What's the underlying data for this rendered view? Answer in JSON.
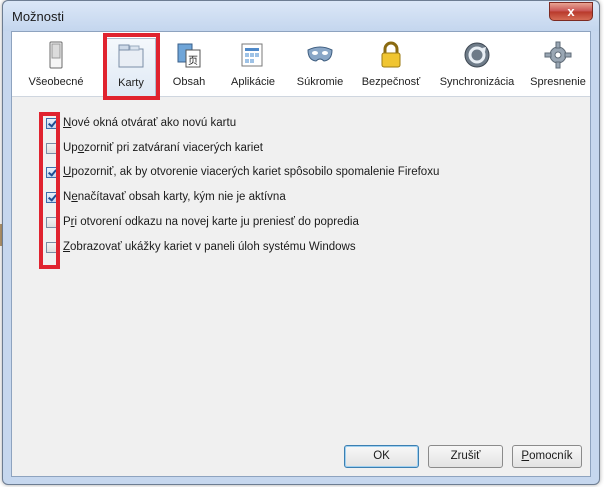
{
  "window": {
    "title": "Možnosti",
    "close_label": "x"
  },
  "toolbar": {
    "tabs": [
      {
        "id": "vseobecne",
        "label": "Všeobecné",
        "icon": "switch-icon"
      },
      {
        "id": "karty",
        "label": "Karty",
        "icon": "tabs-icon"
      },
      {
        "id": "obsah",
        "label": "Obsah",
        "icon": "content-icon"
      },
      {
        "id": "aplikacie",
        "label": "Aplikácie",
        "icon": "applications-icon"
      },
      {
        "id": "sukromie",
        "label": "Súkromie",
        "icon": "mask-icon"
      },
      {
        "id": "bezpecnost",
        "label": "Bezpečnosť",
        "icon": "lock-icon"
      },
      {
        "id": "synchronizacia",
        "label": "Synchronizácia",
        "icon": "sync-icon"
      },
      {
        "id": "spresnenie",
        "label": "Spresnenie",
        "icon": "gear-icon"
      }
    ],
    "selected": "Karty"
  },
  "options": [
    {
      "pre": "",
      "key": "N",
      "post": "ové okná otvárať ako novú kartu",
      "checked": true
    },
    {
      "pre": "Up",
      "key": "o",
      "post": "zorniť pri zatváraní viacerých kariet",
      "checked": false
    },
    {
      "pre": "",
      "key": "U",
      "post": "pozorniť, ak by otvorenie viacerých kariet spôsobilo spomalenie Firefoxu",
      "checked": true
    },
    {
      "pre": "N",
      "key": "e",
      "post": "načítavať obsah karty, kým nie je aktívna",
      "checked": true
    },
    {
      "pre": "P",
      "key": "r",
      "post": "i otvorení odkazu na novej karte ju preniesť do popredia",
      "checked": false
    },
    {
      "pre": "",
      "key": "Z",
      "post": "obrazovať ukážky kariet v paneli úloh systému Windows",
      "checked": false
    }
  ],
  "buttons": {
    "ok": "OK",
    "cancel": "Zrušiť",
    "help_key": "P",
    "help_rest": "omocník"
  },
  "colors": {
    "highlight": "#e0232f",
    "window_frame": "#c6d7ee",
    "panel_bg": "#f0f0f0"
  }
}
